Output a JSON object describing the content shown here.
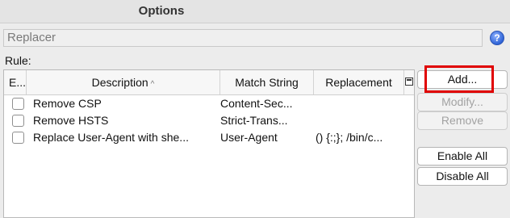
{
  "window": {
    "title": "Options"
  },
  "section": {
    "title": "Replacer"
  },
  "help": {
    "glyph": "?"
  },
  "rules": {
    "label": "Rule:",
    "columns": {
      "enabled": "E...",
      "description": "Description",
      "description_sort": "^",
      "match": "Match String",
      "replacement": "Replacement"
    },
    "rows": [
      {
        "enabled": false,
        "description": "Remove CSP",
        "match": "Content-Sec...",
        "replacement": ""
      },
      {
        "enabled": false,
        "description": "Remove HSTS",
        "match": "Strict-Trans...",
        "replacement": ""
      },
      {
        "enabled": false,
        "description": "Replace User-Agent with she...",
        "match": "User-Agent",
        "replacement": "() {:;}; /bin/c..."
      }
    ]
  },
  "buttons": {
    "add": "Add...",
    "modify": "Modify...",
    "remove": "Remove",
    "enable_all": "Enable All",
    "disable_all": "Disable All"
  },
  "colors": {
    "highlight": "#e00000",
    "help": "#2f63d6"
  }
}
